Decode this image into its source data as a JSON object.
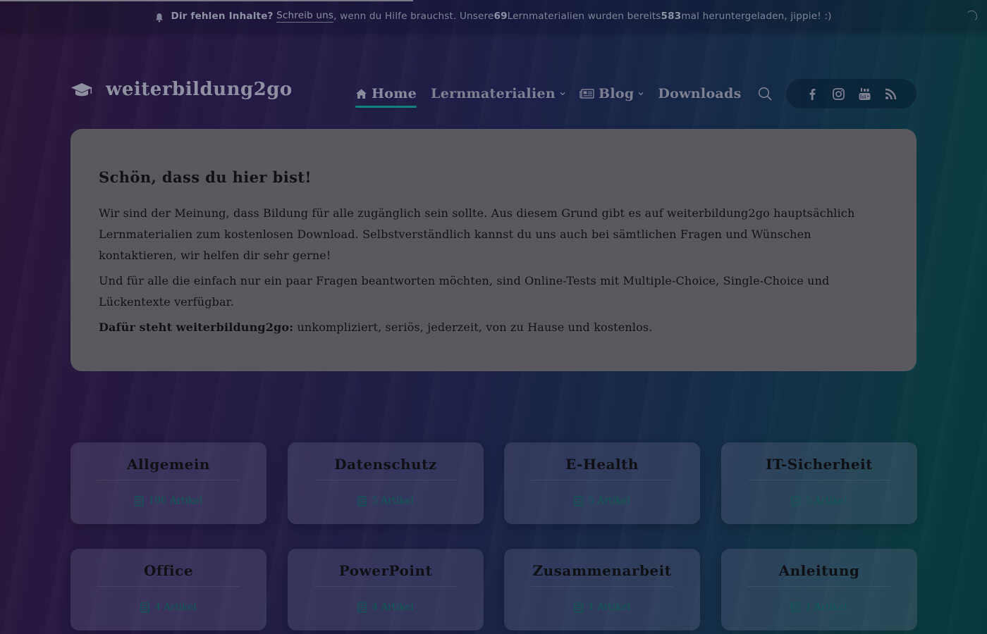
{
  "notice": {
    "lead_bold": "Dir fehlen Inhalte?",
    "link": "Schreib uns",
    "text1": ", wenn du Hilfe brauchst. Unsere ",
    "count_materials": "69",
    "text2": " Lernmaterialien wurden bereits ",
    "count_downloads": "583",
    "text3": " mal heruntergeladen, jippie! :)"
  },
  "brand": {
    "name": "weiterbildung2go",
    "icon": "graduation-cap-icon"
  },
  "nav": {
    "home": "Home",
    "lernmaterialien": "Lernmaterialien",
    "blog": "Blog",
    "downloads": "Downloads"
  },
  "social": [
    "facebook-icon",
    "instagram-icon",
    "youtube-icon",
    "rss-icon"
  ],
  "welcome": {
    "title": "Schön, dass du hier bist!",
    "p1": "Wir sind der Meinung, dass Bildung für alle zugänglich sein sollte. Aus diesem Grund gibt es auf weiterbildung2go hauptsächlich Lernmaterialien zum kostenlosen Download. Selbstverständlich kannst du uns auch bei sämtlichen Fragen und Wünschen kontaktieren, wir helfen dir sehr gerne!",
    "p2": "Und für alle die einfach nur ein paar Fragen beantworten möchten, sind Online-Tests mit Multiple-Choice, Single-Choice und Lückentexte verfügbar.",
    "p3_bold": "Dafür steht weiterbildung2go:",
    "p3_rest": " unkompliziert, seriös, jederzeit, von zu Hause und kostenlos."
  },
  "categories": [
    {
      "title": "Allgemein",
      "count": "106 Artikel"
    },
    {
      "title": "Datenschutz",
      "count": "5 Artikel"
    },
    {
      "title": "E-Health",
      "count": "5 Artikel"
    },
    {
      "title": "IT-Sicherheit",
      "count": "5 Artikel"
    },
    {
      "title": "Office",
      "count": "4 Artikel"
    },
    {
      "title": "PowerPoint",
      "count": "4 Artikel"
    },
    {
      "title": "Zusammenarbeit",
      "count": "1 Artikel"
    },
    {
      "title": "Anleitung",
      "count": "1 Artikel"
    }
  ],
  "colors": {
    "accent": "#147f80",
    "card_bg": "#5a5a5e",
    "count_text": "#0e5d52"
  }
}
